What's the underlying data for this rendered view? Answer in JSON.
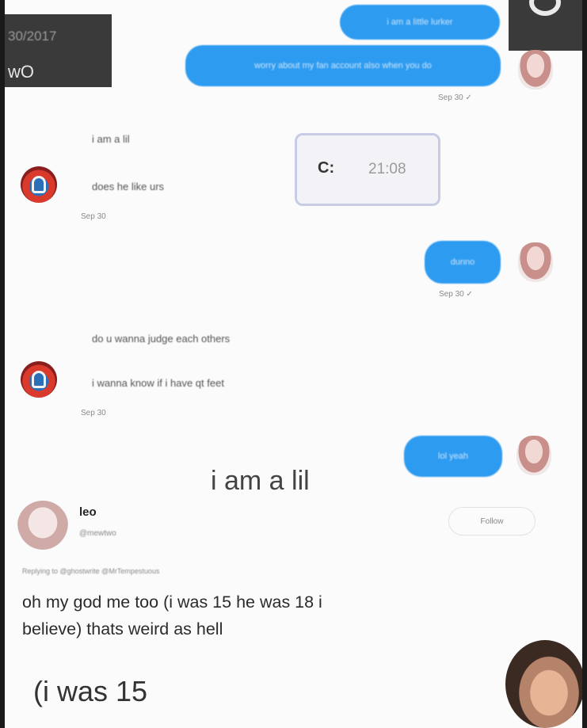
{
  "overlay_topleft": {
    "date": "30/2017",
    "label": "wO"
  },
  "dm": {
    "outgoing_1": "i am a little lurker",
    "outgoing_2": "worry about my fan account also when you do",
    "outgoing_2_time": "Sep 30 ✓",
    "incoming_1_a": "i am a lil",
    "incoming_1_b": "does he like urs",
    "incoming_1_time": "Sep 30",
    "clock_overlay": {
      "label": "C:",
      "time": "21:08"
    },
    "outgoing_3": "dunno",
    "outgoing_3_time": "Sep 30 ✓",
    "incoming_2_a": "do u wanna judge each others",
    "incoming_2_b": "i wanna know if i have qt feet",
    "incoming_2_time": "Sep 30",
    "outgoing_4": "lol yeah"
  },
  "caption_overlay": "i am a lil",
  "tweet": {
    "name": "leo",
    "handle": "@mewtwo",
    "follow_label": "Follow",
    "replying_to": "Replying to @ghostwrite @MrTempestuous",
    "text_line1": "oh my god me too (i was 15 he was 18 i",
    "text_line2": "believe) thats weird as hell"
  },
  "bottom_caption": "(i was 15",
  "colors": {
    "bubble_blue": "#2d9bf0",
    "background": "#fbfbfb",
    "overlay_dark": "#3a3a3a"
  }
}
